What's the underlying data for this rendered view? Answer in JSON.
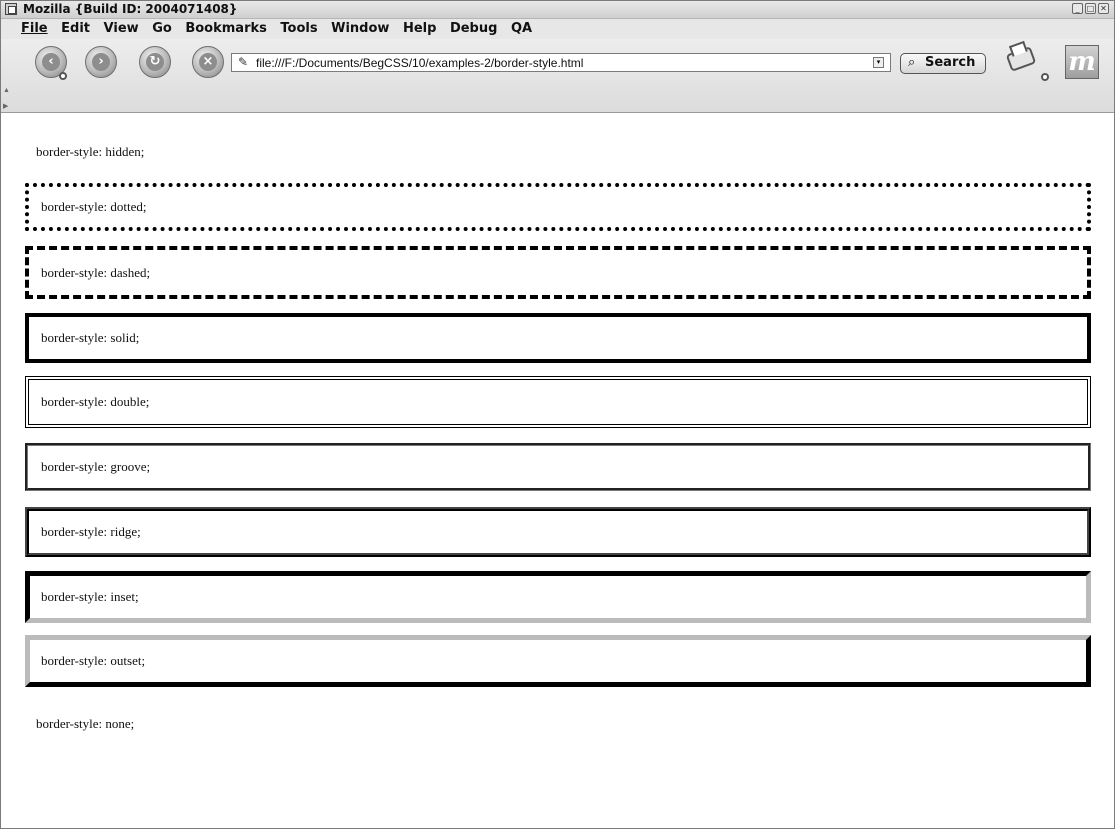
{
  "window": {
    "title": "Mozilla {Build ID: 2004071408}",
    "controls": [
      "_",
      "□",
      "✕"
    ]
  },
  "menu": {
    "items": [
      "File",
      "Edit",
      "View",
      "Go",
      "Bookmarks",
      "Tools",
      "Window",
      "Help",
      "Debug",
      "QA"
    ]
  },
  "toolbar": {
    "back_icon": "back-arrow-icon",
    "forward_icon": "forward-arrow-icon",
    "reload_icon": "reload-icon",
    "stop_icon": "stop-icon",
    "url": "file:///F:/Documents/BegCSS/10/examples-2/border-style.html",
    "search_label": "Search",
    "print_icon": "printer-icon",
    "throbber_glyph": "m"
  },
  "content": {
    "boxes": [
      "border-style: hidden;",
      "border-style: dotted;",
      "border-style: dashed;",
      "border-style: solid;",
      "border-style: double;",
      "border-style: groove;",
      "border-style: ridge;",
      "border-style: inset;",
      "border-style: outset;",
      "border-style: none;"
    ]
  }
}
